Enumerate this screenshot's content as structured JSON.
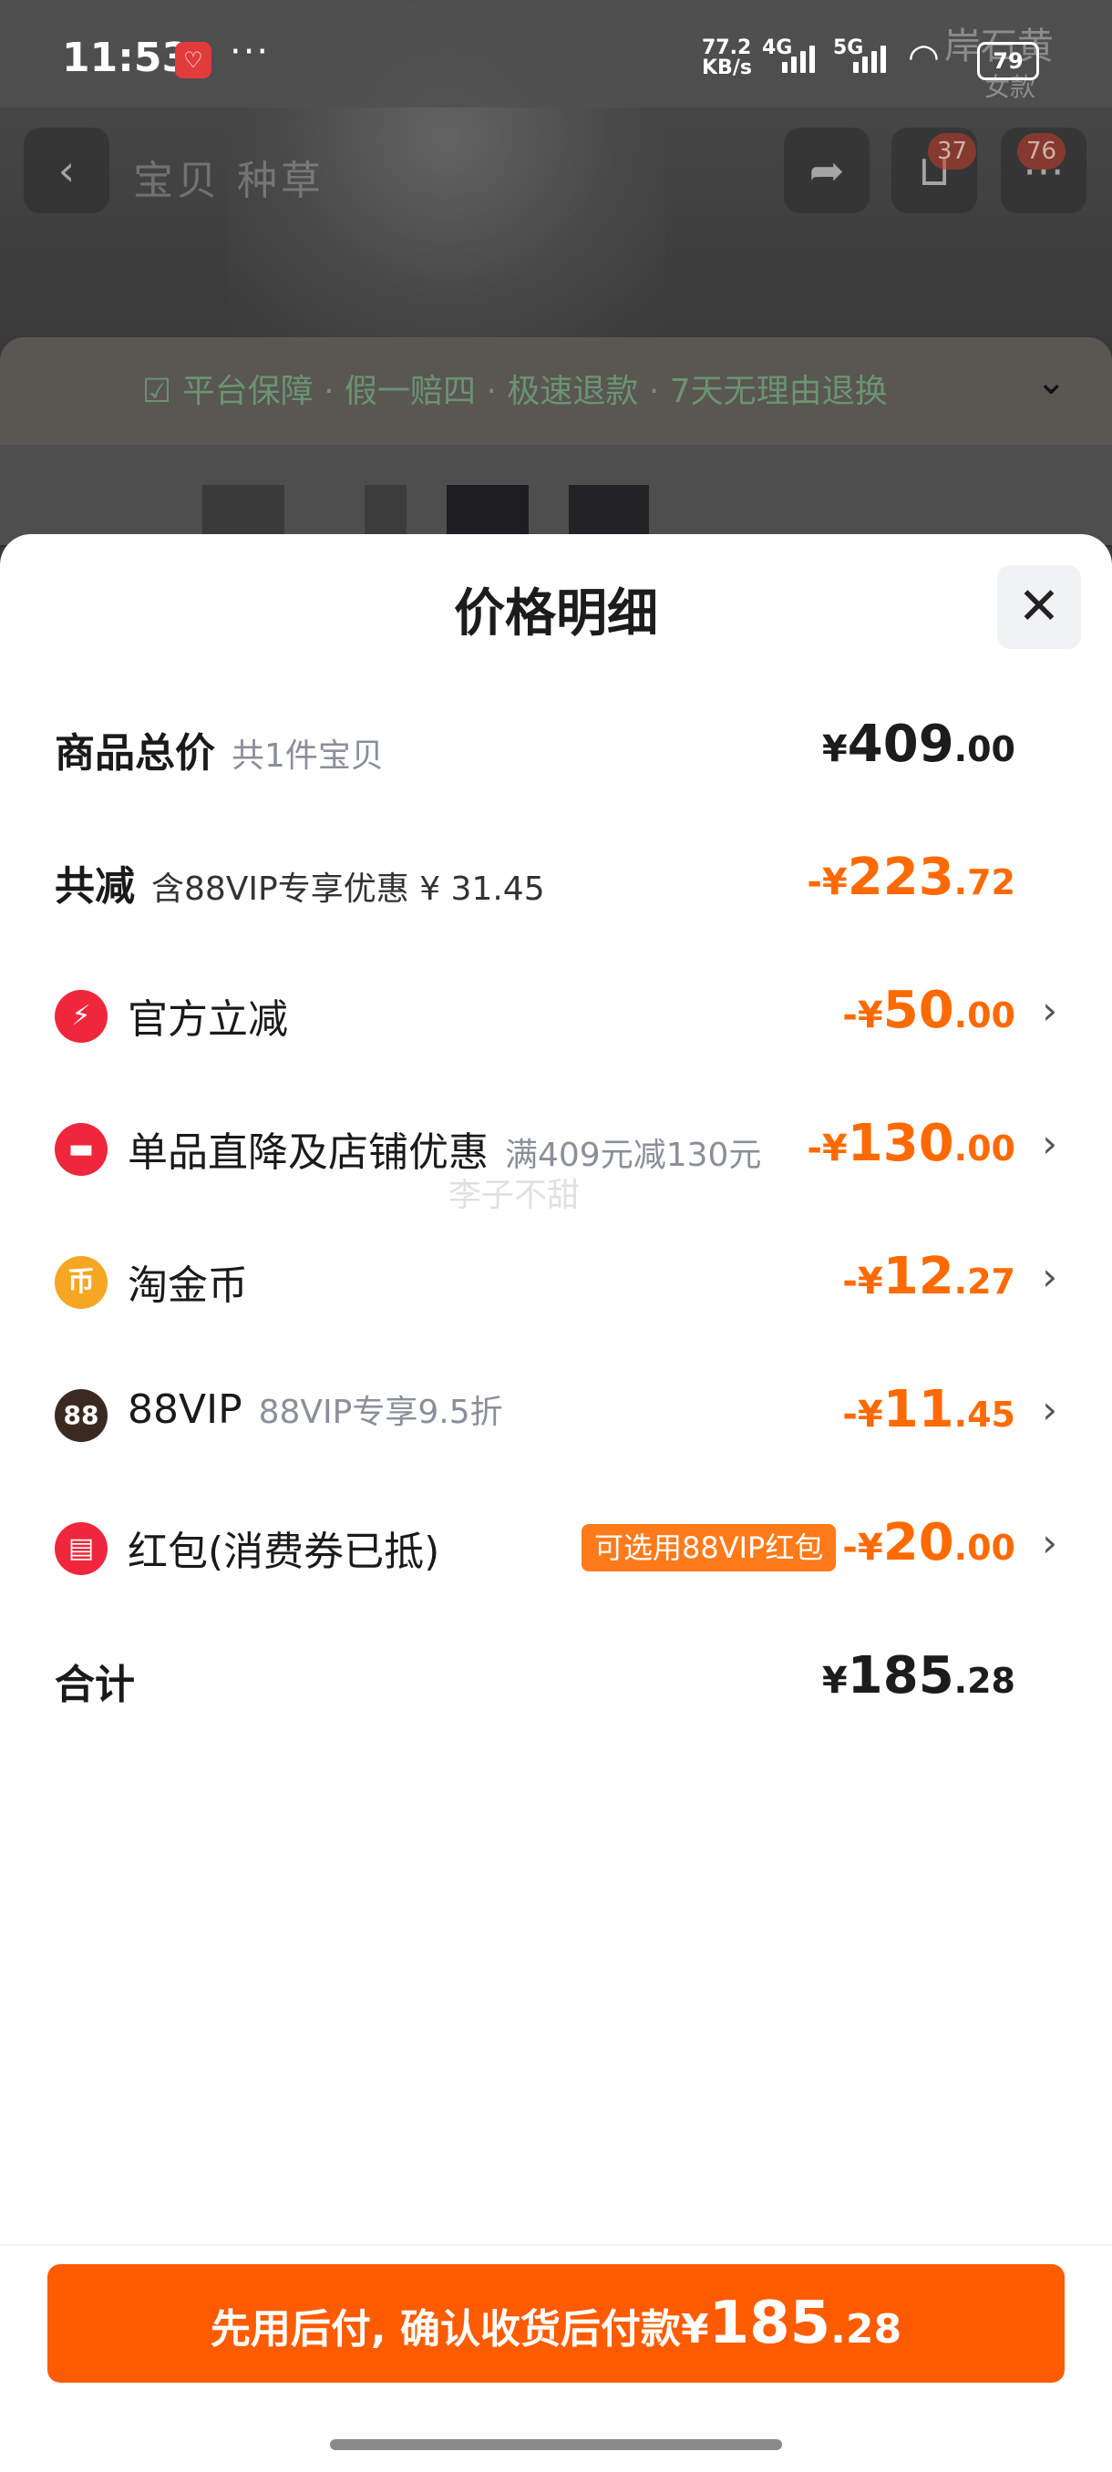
{
  "status_bar": {
    "time": "11:53",
    "more": "···",
    "speed_value": "77.2",
    "speed_unit": "KB/s",
    "net1": "4G",
    "net2": "5G",
    "battery": "79",
    "side_text_1": "岸石黄",
    "side_text_2": "女款"
  },
  "nav": {
    "tabs": "宝贝  种草",
    "badge_cart": "37",
    "badge_more": "76"
  },
  "guarantee": {
    "text": "☑ 平台保障 · 假一赔四 · 极速退款 · 7天无理由退换"
  },
  "sheet": {
    "title": "价格明细",
    "rows": [
      {
        "label": "商品总价",
        "sub": "共1件宝贝",
        "cur": "¥",
        "int": "409",
        "dec": ".00"
      },
      {
        "label": "共减",
        "sub": "含88VIP专享优惠 ¥ 31.45",
        "cur": "-¥",
        "int": "223",
        "dec": ".72"
      },
      {
        "label": "官方立减",
        "icon": "lightning-icon",
        "cur": "-¥",
        "int": "50",
        "dec": ".00"
      },
      {
        "label": "单品直降及店铺优惠",
        "sub": "满409元减130元",
        "icon": "shop-icon",
        "cur": "-¥",
        "int": "130",
        "dec": ".00"
      },
      {
        "label": "淘金币",
        "icon": "coin-icon",
        "icon_glyph": "币",
        "cur": "-¥",
        "int": "12",
        "dec": ".27"
      },
      {
        "label": "88VIP",
        "sub": "88VIP专享9.5折",
        "icon": "vip-icon",
        "icon_glyph": "88",
        "cur": "-¥",
        "int": "11",
        "dec": ".45"
      },
      {
        "label": "红包(消费券已抵)",
        "tag": "可选用88VIP红包",
        "icon": "red-packet-icon",
        "cur": "-¥",
        "int": "20",
        "dec": ".00"
      },
      {
        "label": "合计",
        "cur": "¥",
        "int": "185",
        "dec": ".28"
      }
    ],
    "watermark": "李子不甜"
  },
  "pay_button": {
    "text": "先用后付, 确认收货后付款",
    "cur": "¥",
    "int": "185",
    "dec": ".28"
  },
  "colors": {
    "accent": "#ff5b00",
    "discount": "#ff6a00",
    "icon_red": "#f0263c",
    "icon_gold": "#f5a623",
    "icon_dark": "#3a2a22"
  }
}
